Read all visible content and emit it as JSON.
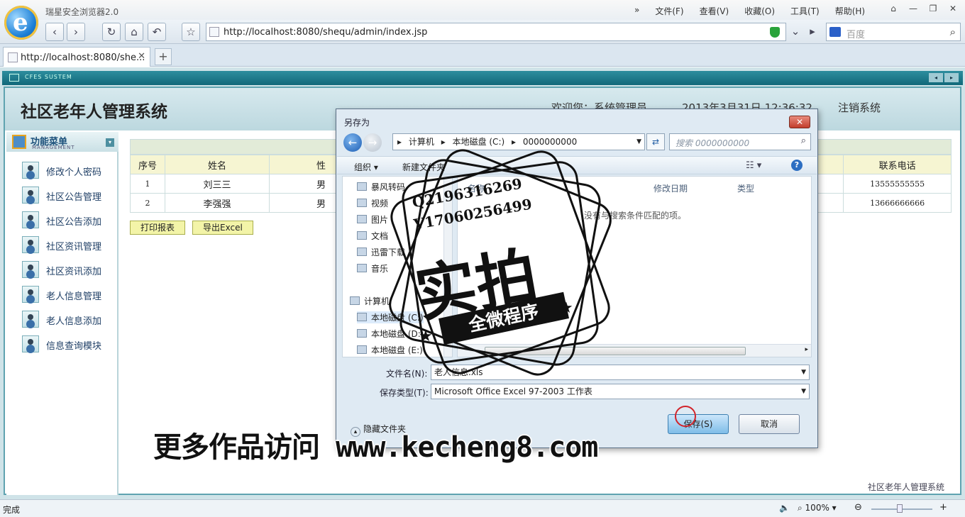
{
  "browser": {
    "app_title": "瑞星安全浏览器2.0",
    "menu": [
      "文件(F)",
      "查看(V)",
      "收藏(O)",
      "工具(T)",
      "帮助(H)"
    ],
    "menu_more": "»",
    "url": "http://localhost:8080/shequ/admin/index.jsp",
    "search_placeholder": "百度",
    "tab_title": "http://localhost:8080/she...",
    "new_tab": "+",
    "status_text": "完成",
    "zoom": "100%"
  },
  "page": {
    "sysbar_label": "CFES SUSTEM",
    "system_title": "社区老年人管理系统",
    "welcome": "欢迎您：系统管理员",
    "datetime": "2013年3月31日  12:36:32",
    "logout": "注销系统",
    "footer": "社区老年人管理系统"
  },
  "sidebar": {
    "title": "功能菜单",
    "subtitle": "MANAGEMENT",
    "items": [
      {
        "label": "修改个人密码"
      },
      {
        "label": "社区公告管理"
      },
      {
        "label": "社区公告添加"
      },
      {
        "label": "社区资讯管理"
      },
      {
        "label": "社区资讯添加"
      },
      {
        "label": "老人信息管理"
      },
      {
        "label": "老人信息添加"
      },
      {
        "label": "信息查询模块"
      }
    ]
  },
  "table": {
    "headers": [
      "序号",
      "姓名",
      "性",
      "联系电话"
    ],
    "rows": [
      {
        "no": "1",
        "name": "刘三三",
        "sex": "男",
        "phone": "13555555555"
      },
      {
        "no": "2",
        "name": "李强强",
        "sex": "男",
        "phone": "13666666666"
      }
    ],
    "print_button": "打印报表",
    "export_button": "导出Excel"
  },
  "dialog": {
    "title": "另存为",
    "breadcrumb": [
      "计算机",
      "本地磁盘 (C:)",
      "0000000000"
    ],
    "search_placeholder": "搜索 0000000000",
    "organize": "组织 ▾",
    "new_folder": "新建文件夹",
    "nav_items": [
      "暴风转码",
      "视频",
      "图片",
      "文档",
      "迅雷下载",
      "音乐",
      "计算机",
      "本地磁盘 (C:)",
      "本地磁盘 (D:)",
      "本地磁盘 (E:)"
    ],
    "columns": [
      "名称",
      "修改日期",
      "类型"
    ],
    "empty_message": "没有与搜索条件匹配的项。",
    "filename_label": "文件名(N):",
    "filename_value": "老人信息.xls",
    "filetype_label": "保存类型(T):",
    "filetype_value": "Microsoft Office Excel 97-2003 工作表",
    "hide_folders": "隐藏文件夹",
    "save_button": "保存(S)",
    "cancel_button": "取消"
  },
  "watermark": {
    "line1": "Q2196316269",
    "line2": "V17060256499",
    "big": "实拍",
    "banner": "全微程序",
    "promo": "更多作品访问 www.kecheng8.com"
  }
}
